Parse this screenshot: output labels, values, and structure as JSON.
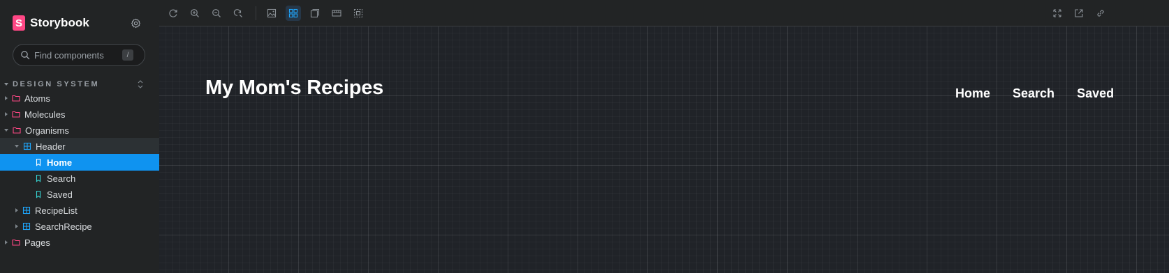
{
  "app": {
    "brand": "Storybook"
  },
  "search": {
    "placeholder": "Find components",
    "shortcut": "/"
  },
  "section": {
    "label": "DESIGN SYSTEM"
  },
  "tree": {
    "atoms": "Atoms",
    "molecules": "Molecules",
    "organisms": "Organisms",
    "header": "Header",
    "home": "Home",
    "search": "Search",
    "saved": "Saved",
    "recipelist": "RecipeList",
    "searchrecipe": "SearchRecipe",
    "pages": "Pages"
  },
  "toolbar": {
    "left": [
      "remount-icon",
      "zoom-in-icon",
      "zoom-out-icon",
      "zoom-reset-icon",
      "background-icon",
      "grid-icon",
      "viewport-icon",
      "measure-icon",
      "outline-icon"
    ],
    "right": [
      "fullscreen-icon",
      "open-new-tab-icon",
      "copy-link-icon"
    ],
    "active": "grid-icon"
  },
  "preview": {
    "title": "My Mom's Recipes",
    "nav": [
      "Home",
      "Search",
      "Saved"
    ]
  },
  "colors": {
    "brand": "#ff4785",
    "selected": "#0f93f0",
    "folder": "#ff4785",
    "component": "#1ea7fd",
    "story": "#37d5d3"
  }
}
